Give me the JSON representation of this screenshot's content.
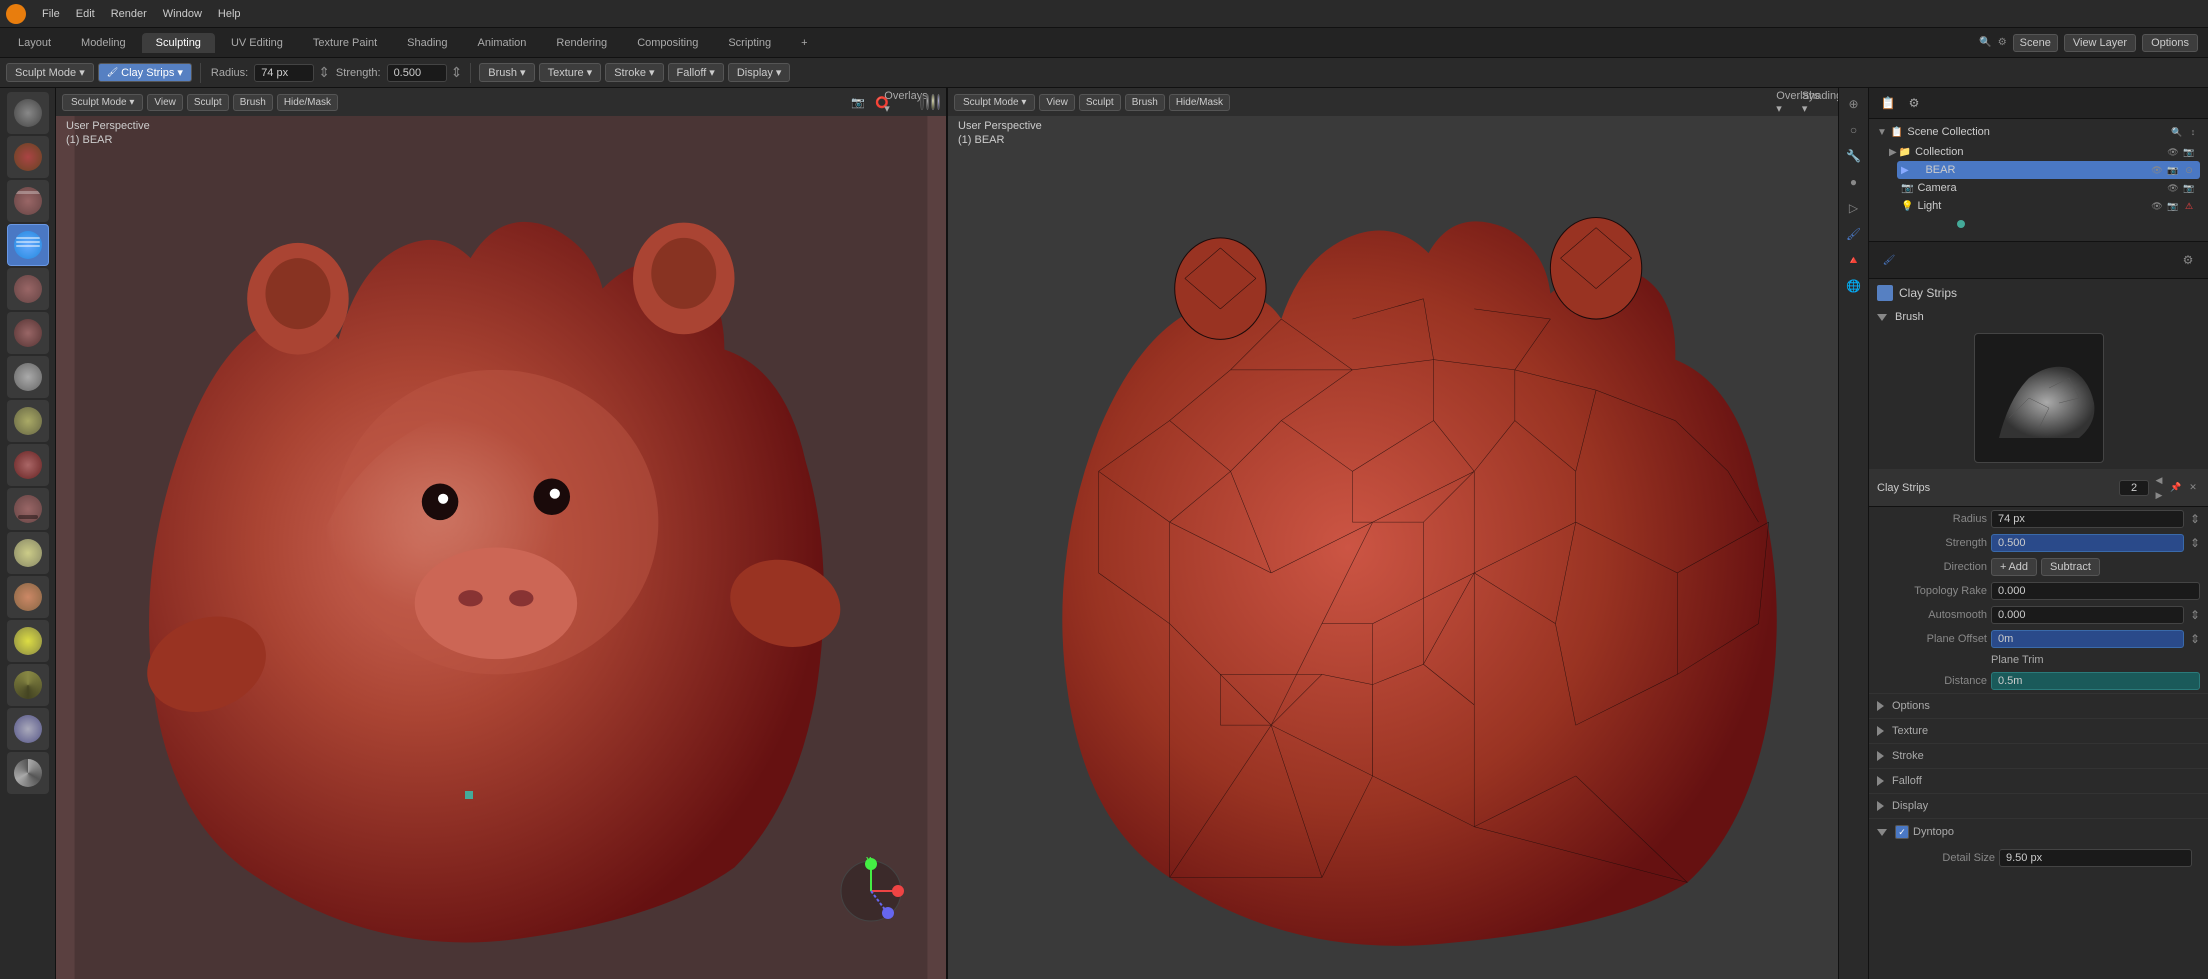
{
  "app": {
    "title": "Blender",
    "logo_color": "#e87d0d"
  },
  "top_menu": {
    "items": [
      "File",
      "Edit",
      "Render",
      "Window",
      "Help"
    ]
  },
  "workspace_tabs": {
    "items": [
      "Layout",
      "Modeling",
      "Sculpting",
      "UV Editing",
      "Texture Paint",
      "Shading",
      "Animation",
      "Rendering",
      "Compositing",
      "Scripting",
      "+"
    ],
    "active": "Sculpting"
  },
  "header_right": {
    "scene_label": "Scene",
    "view_layer_label": "View Layer",
    "options_label": "Options"
  },
  "toolbar": {
    "brush_name": "Clay Strips",
    "radius_label": "Radius:",
    "radius_value": "74 px",
    "strength_label": "Strength:",
    "strength_value": "0.500",
    "brush_label": "Brush",
    "texture_label": "Texture",
    "stroke_label": "Stroke",
    "falloff_label": "Falloff",
    "display_label": "Display"
  },
  "viewport1": {
    "mode": "Sculpt Mode",
    "perspective": "User Perspective",
    "object": "(1) BEAR",
    "overlay_label": "Overlays",
    "shading_label": "Shading"
  },
  "viewport2": {
    "mode": "Sculpt Mode",
    "perspective": "User Perspective",
    "object": "(1) BEAR",
    "overlay_label": "Overlays",
    "shading_label": "Shading"
  },
  "scene_collection": {
    "title": "Scene Collection",
    "items": [
      {
        "name": "Collection",
        "type": "collection",
        "indent": 1,
        "active": false
      },
      {
        "name": "BEAR",
        "type": "mesh",
        "indent": 2,
        "active": true
      },
      {
        "name": "Camera",
        "type": "camera",
        "indent": 2,
        "active": false
      },
      {
        "name": "Light",
        "type": "light",
        "indent": 2,
        "active": false
      }
    ]
  },
  "brush_panel": {
    "title": "Brush",
    "brush_name": "Clay Strips",
    "sections": [
      "Options",
      "Texture",
      "Stroke",
      "Falloff",
      "Display",
      "Dyntopo"
    ]
  },
  "clay_strips": {
    "title": "Clay Strips",
    "number": "2",
    "radius_label": "Radius",
    "radius_value": "74 px",
    "strength_label": "Strength",
    "strength_value": "0.500",
    "direction_label": "Direction",
    "add_label": "Add",
    "subtract_label": "Subtract",
    "topology_rake_label": "Topology Rake",
    "topology_rake_value": "0.000",
    "autosmooth_label": "Autosmooth",
    "autosmooth_value": "0.000",
    "plane_offset_label": "Plane Offset",
    "plane_offset_value": "0m",
    "plane_trim_label": "Plane Trim",
    "distance_label": "Distance",
    "distance_value": "0.5m",
    "options_label": "Options",
    "texture_label": "Texture",
    "stroke_label": "Stroke",
    "falloff_label": "Falloff",
    "display_label": "Display",
    "dyntopo_label": "Dyntopo",
    "dyntopo_checked": true,
    "detail_size_label": "Detail Size",
    "detail_size_value": "9.50 px"
  }
}
